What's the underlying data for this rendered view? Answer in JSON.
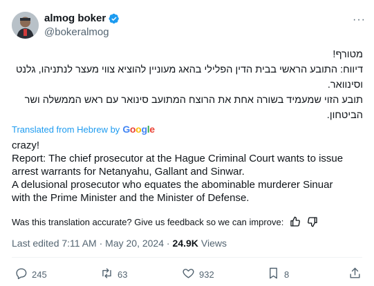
{
  "author": {
    "name": "almog boker",
    "handle": "@bokeralmog"
  },
  "more_label": "···",
  "tweet": {
    "hebrew_lines": [
      "מטורף!",
      "דיווח: התובע הראשי בבית הדין הפלילי בהאג מעוניין להוציא צווי מעצר לנתניהו, גלנט",
      "וסינוואר.",
      "תובע הזוי שמעמיד בשורה אחת את הרוצח המתועב סינואר עם ראש הממשלה ושר",
      "הביטחון."
    ],
    "translated_label": "Translated from Hebrew by",
    "google_letters": [
      "G",
      "o",
      "o",
      "g",
      "l",
      "e"
    ],
    "english_lines": [
      "crazy!",
      "Report: The chief prosecutor at the Hague Criminal Court wants to issue",
      "arrest warrants for Netanyahu, Gallant and Sinwar.",
      "A delusional prosecutor who equates the abominable murderer Sinuar",
      "with the Prime Minister and the Minister of Defense."
    ],
    "feedback_prompt": "Was this translation accurate? Give us feedback so we can improve:"
  },
  "meta": {
    "edited": "Last edited 7:11 AM · May 20, 2024 ·",
    "views_count": "24.9K",
    "views_label": "Views"
  },
  "actions": {
    "replies": "245",
    "reposts": "63",
    "likes": "932",
    "bookmarks": "8"
  },
  "colors": {
    "link": "#1d9bf0",
    "secondary_text": "#536471",
    "google": [
      "#4285F4",
      "#EA4335",
      "#FBBC05",
      "#4285F4",
      "#34A853",
      "#EA4335"
    ]
  }
}
